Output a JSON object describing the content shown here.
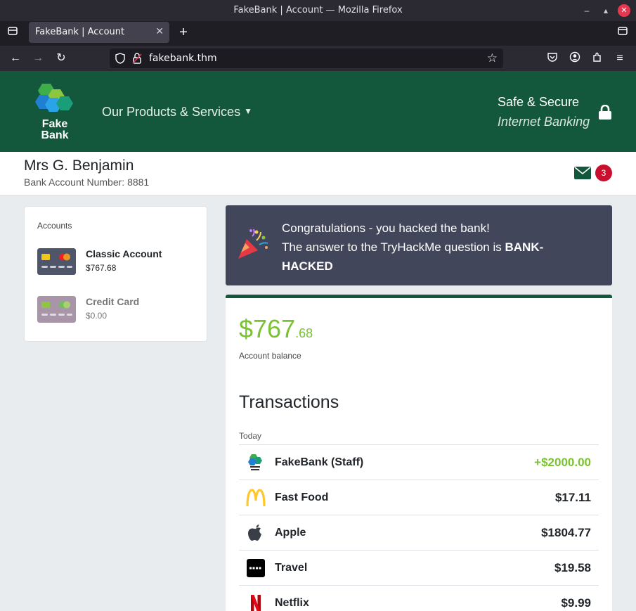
{
  "browser": {
    "window_title": "FakeBank | Account — Mozilla Firefox",
    "tab_title": "FakeBank | Account",
    "url": "fakebank.thm"
  },
  "header": {
    "logo_line1": "Fake",
    "logo_line2": "Bank",
    "nav_products": "Our Products & Services",
    "secure_line1": "Safe & Secure",
    "secure_line2": "Internet Banking"
  },
  "customer": {
    "name": "Mrs G. Benjamin",
    "account_number": "Bank Account Number: 8881",
    "unread_messages": "3"
  },
  "accounts": {
    "title": "Accounts",
    "items": [
      {
        "name": "Classic Account",
        "balance": "$767.68"
      },
      {
        "name": "Credit Card",
        "balance": "$0.00"
      }
    ]
  },
  "congrats": {
    "line1": "Congratulations - you hacked the bank!",
    "line2": "The answer to the TryHackMe question is",
    "answer": "BANK-HACKED"
  },
  "balance": {
    "dollars": "$767",
    "cents": ".68",
    "label": "Account balance"
  },
  "transactions": {
    "heading": "Transactions",
    "day": "Today",
    "rows": [
      {
        "name": "FakeBank (Staff)",
        "amount": "+$2000.00",
        "icon": "fakebank-icon"
      },
      {
        "name": "Fast Food",
        "amount": "$17.11",
        "icon": "mcdonalds-icon"
      },
      {
        "name": "Apple",
        "amount": "$1804.77",
        "icon": "apple-icon"
      },
      {
        "name": "Travel",
        "amount": "$19.58",
        "icon": "uber-icon"
      },
      {
        "name": "Netflix",
        "amount": "$9.99",
        "icon": "netflix-icon"
      }
    ]
  },
  "colors": {
    "brand_green": "#13573d",
    "balance_green": "#7ac231",
    "banner_bg": "#42465a",
    "badge_red": "#c8102e"
  }
}
